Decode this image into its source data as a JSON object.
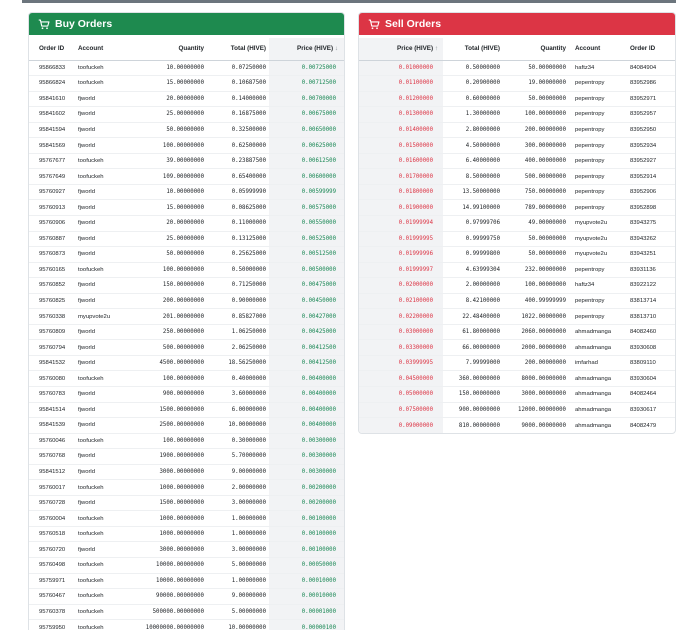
{
  "buy": {
    "title": "Buy Orders",
    "columns": [
      "Order ID",
      "Account",
      "Quantity",
      "Total (HIVE)",
      "Price (HIVE)"
    ],
    "sort_indicator": "↓",
    "rows": [
      [
        "95866833",
        "toofuckeh",
        "10.00000000",
        "0.07250000",
        "0.00725000"
      ],
      [
        "95866824",
        "toofuckeh",
        "15.00000000",
        "0.10687500",
        "0.00712500"
      ],
      [
        "95841610",
        "fjworld",
        "20.00000000",
        "0.14000000",
        "0.00700000"
      ],
      [
        "95841602",
        "fjworld",
        "25.00000000",
        "0.16875000",
        "0.00675000"
      ],
      [
        "95841594",
        "fjworld",
        "50.00000000",
        "0.32500000",
        "0.00650000"
      ],
      [
        "95841569",
        "fjworld",
        "100.00000000",
        "0.62500000",
        "0.00625000"
      ],
      [
        "95767677",
        "toofuckeh",
        "39.00000000",
        "0.23887500",
        "0.00612500"
      ],
      [
        "95767649",
        "toofuckeh",
        "109.00000000",
        "0.65400000",
        "0.00600000"
      ],
      [
        "95760927",
        "fjworld",
        "10.00000000",
        "0.05999990",
        "0.00599999"
      ],
      [
        "95760913",
        "fjworld",
        "15.00000000",
        "0.08625000",
        "0.00575000"
      ],
      [
        "95760906",
        "fjworld",
        "20.00000000",
        "0.11000000",
        "0.00550000"
      ],
      [
        "95760887",
        "fjworld",
        "25.00000000",
        "0.13125000",
        "0.00525000"
      ],
      [
        "95760873",
        "fjworld",
        "50.00000000",
        "0.25625000",
        "0.00512500"
      ],
      [
        "95760165",
        "toofuckeh",
        "100.00000000",
        "0.50000000",
        "0.00500000"
      ],
      [
        "95760852",
        "fjworld",
        "150.00000000",
        "0.71250000",
        "0.00475000"
      ],
      [
        "95760825",
        "fjworld",
        "200.00000000",
        "0.90000000",
        "0.00450000"
      ],
      [
        "95760338",
        "myupvote2u",
        "201.00000000",
        "0.85827000",
        "0.00427000"
      ],
      [
        "95760809",
        "fjworld",
        "250.00000000",
        "1.06250000",
        "0.00425000"
      ],
      [
        "95760794",
        "fjworld",
        "500.00000000",
        "2.06250000",
        "0.00412500"
      ],
      [
        "95841532",
        "fjworld",
        "4500.00000000",
        "18.56250000",
        "0.00412500"
      ],
      [
        "95760080",
        "toofuckeh",
        "100.00000000",
        "0.40000000",
        "0.00400000"
      ],
      [
        "95760783",
        "fjworld",
        "900.00000000",
        "3.60000000",
        "0.00400000"
      ],
      [
        "95841514",
        "fjworld",
        "1500.00000000",
        "6.00000000",
        "0.00400000"
      ],
      [
        "95841539",
        "fjworld",
        "2500.00000000",
        "10.00000000",
        "0.00400000"
      ],
      [
        "95760046",
        "toofuckeh",
        "100.00000000",
        "0.30000000",
        "0.00300000"
      ],
      [
        "95760768",
        "fjworld",
        "1900.00000000",
        "5.70000000",
        "0.00300000"
      ],
      [
        "95841512",
        "fjworld",
        "3000.00000000",
        "9.00000000",
        "0.00300000"
      ],
      [
        "95760017",
        "toofuckeh",
        "1000.00000000",
        "2.00000000",
        "0.00200000"
      ],
      [
        "95760728",
        "fjworld",
        "1500.00000000",
        "3.00000000",
        "0.00200000"
      ],
      [
        "95760004",
        "toofuckeh",
        "1000.00000000",
        "1.00000000",
        "0.00100000"
      ],
      [
        "95760518",
        "toofuckeh",
        "1000.00000000",
        "1.00000000",
        "0.00100000"
      ],
      [
        "95760720",
        "fjworld",
        "3000.00000000",
        "3.00000000",
        "0.00100000"
      ],
      [
        "95760498",
        "toofuckeh",
        "10000.00000000",
        "5.00000000",
        "0.00050000"
      ],
      [
        "95759971",
        "toofuckeh",
        "10000.00000000",
        "1.00000000",
        "0.00010000"
      ],
      [
        "95760467",
        "toofuckeh",
        "90000.00000000",
        "9.00000000",
        "0.00010000"
      ],
      [
        "95760378",
        "toofuckeh",
        "500000.00000000",
        "5.00000000",
        "0.00001000"
      ],
      [
        "95759950",
        "toofuckeh",
        "10000000.00000000",
        "10.00000000",
        "0.00000100"
      ]
    ]
  },
  "sell": {
    "title": "Sell Orders",
    "columns": [
      "Price (HIVE)",
      "Total (HIVE)",
      "Quantity",
      "Account",
      "Order ID"
    ],
    "sort_indicator": "↑",
    "rows": [
      [
        "0.01000000",
        "0.50000000",
        "50.00000000",
        "haftz34",
        "84084904"
      ],
      [
        "0.01100000",
        "0.20900000",
        "19.00000000",
        "pepentropy",
        "83952986"
      ],
      [
        "0.01200000",
        "0.60000000",
        "50.00000000",
        "pepentropy",
        "83952971"
      ],
      [
        "0.01300000",
        "1.30000000",
        "100.00000000",
        "pepentropy",
        "83952957"
      ],
      [
        "0.01400000",
        "2.80000000",
        "200.00000000",
        "pepentropy",
        "83952950"
      ],
      [
        "0.01500000",
        "4.50000000",
        "300.00000000",
        "pepentropy",
        "83952934"
      ],
      [
        "0.01600000",
        "6.40000000",
        "400.00000000",
        "pepentropy",
        "83952927"
      ],
      [
        "0.01700000",
        "8.50000000",
        "500.00000000",
        "pepentropy",
        "83952914"
      ],
      [
        "0.01800000",
        "13.50000000",
        "750.00000000",
        "pepentropy",
        "83952906"
      ],
      [
        "0.01900000",
        "14.99100000",
        "789.00000000",
        "pepentropy",
        "83952898"
      ],
      [
        "0.01999994",
        "0.97999706",
        "49.00000000",
        "myupvote2u",
        "83943275"
      ],
      [
        "0.01999995",
        "0.99999750",
        "50.00000000",
        "myupvote2u",
        "83943262"
      ],
      [
        "0.01999996",
        "0.99999800",
        "50.00000000",
        "myupvote2u",
        "83943251"
      ],
      [
        "0.01999997",
        "4.63999304",
        "232.00000000",
        "pepentropy",
        "83931136"
      ],
      [
        "0.02000000",
        "2.00000000",
        "100.00000000",
        "haftz34",
        "83922122"
      ],
      [
        "0.02100000",
        "8.42100000",
        "400.99999999",
        "pepentropy",
        "83813714"
      ],
      [
        "0.02200000",
        "22.48400000",
        "1022.00000000",
        "pepentropy",
        "83813710"
      ],
      [
        "0.03000000",
        "61.80000000",
        "2060.00000000",
        "ahmadmanga",
        "84082460"
      ],
      [
        "0.03300000",
        "66.00000000",
        "2000.00000000",
        "ahmadmanga",
        "83930608"
      ],
      [
        "0.03999995",
        "7.99999000",
        "200.00000000",
        "imfarhad",
        "83809110"
      ],
      [
        "0.04500000",
        "360.00000000",
        "8000.00000000",
        "ahmadmanga",
        "83930604"
      ],
      [
        "0.05000000",
        "150.00000000",
        "3000.00000000",
        "ahmadmanga",
        "84082464"
      ],
      [
        "0.07500000",
        "900.00000000",
        "12000.00000000",
        "ahmadmanga",
        "83930617"
      ],
      [
        "0.09000000",
        "810.00000000",
        "9000.00000000",
        "ahmadmanga",
        "84082479"
      ]
    ]
  },
  "colors": {
    "buy_header": "#1e8a4f",
    "sell_header": "#dc3545",
    "buy_price": "#198754",
    "sell_price": "#dc3545"
  },
  "icons": {
    "buy": "cart-icon",
    "sell": "cart-icon"
  }
}
